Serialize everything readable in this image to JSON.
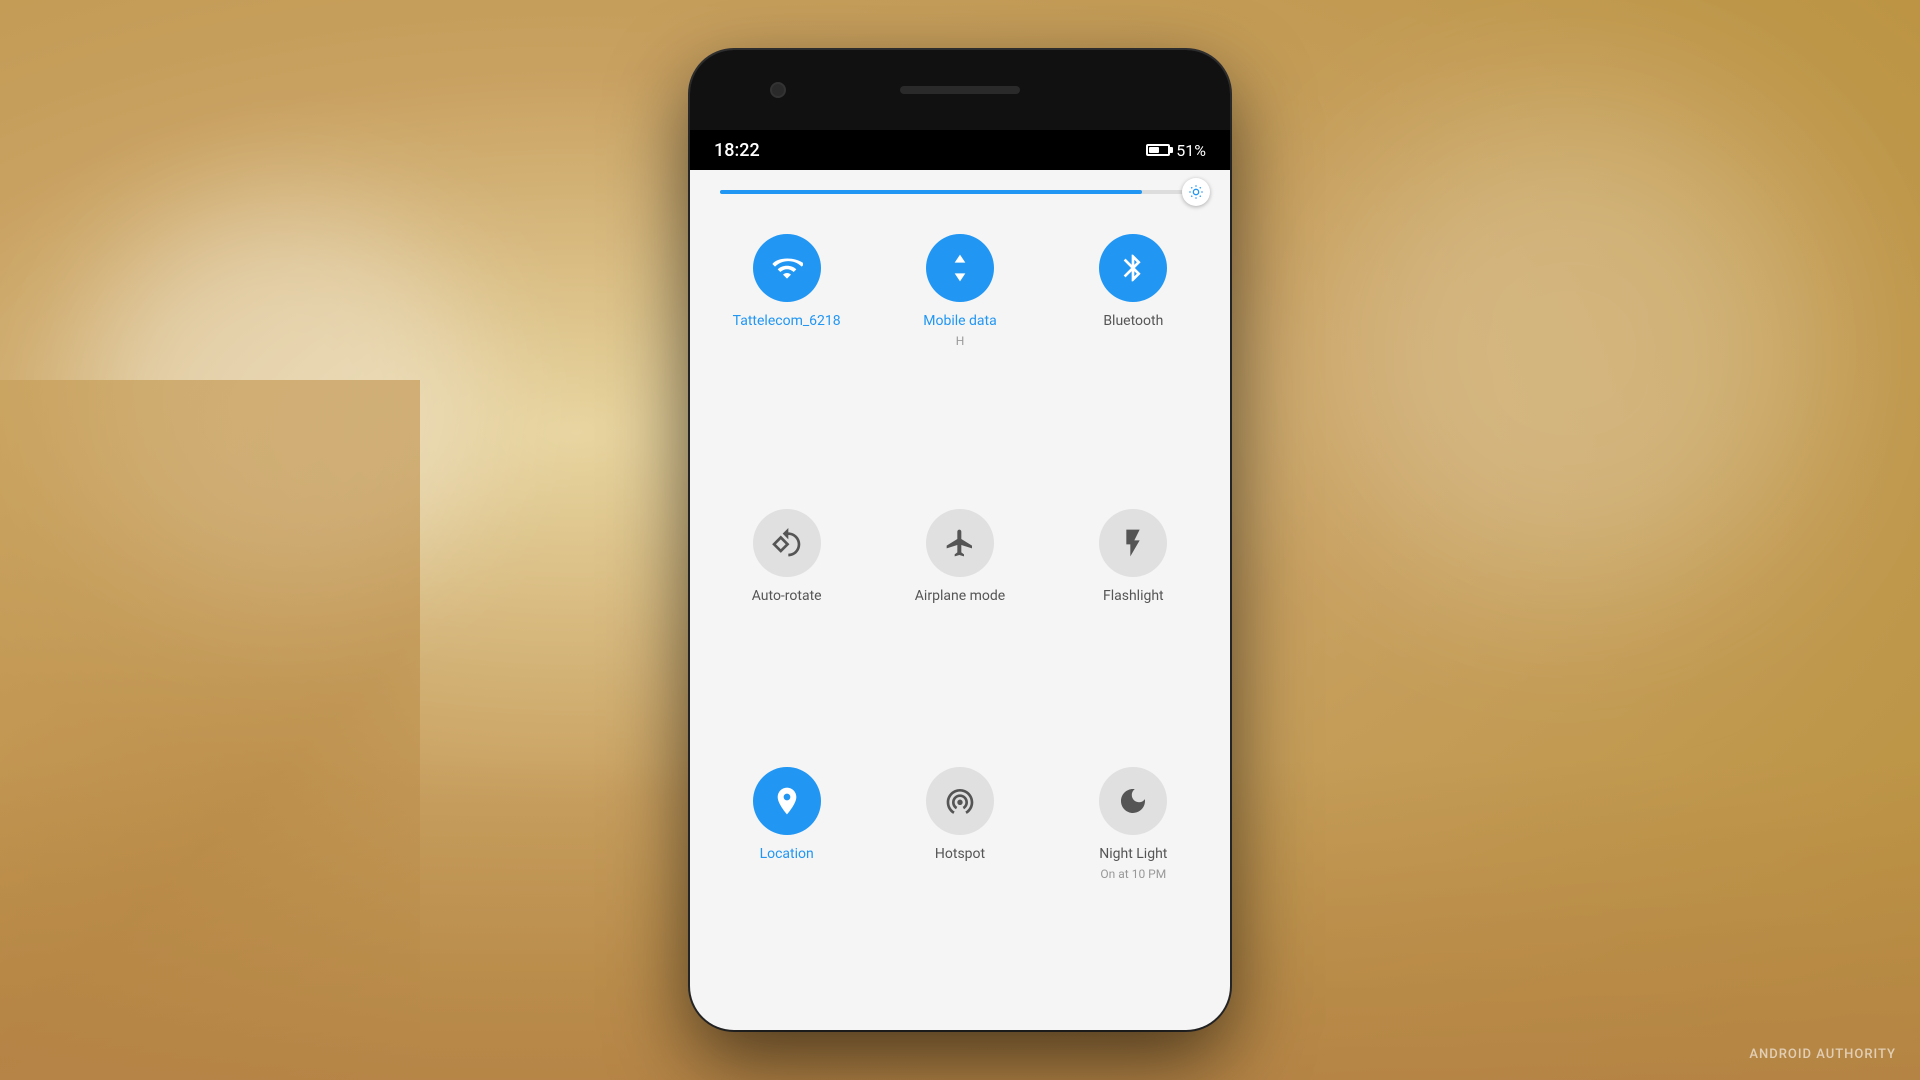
{
  "background": {
    "color": "#c8a060"
  },
  "status_bar": {
    "time": "18:22",
    "battery_percent": "51%"
  },
  "brightness_slider": {
    "fill_percent": 88,
    "aria_label": "Brightness slider"
  },
  "tiles": [
    {
      "id": "wifi",
      "label": "Tattelecom_6218",
      "sublabel": "",
      "active": true,
      "icon": "wifi"
    },
    {
      "id": "mobile-data",
      "label": "Mobile data",
      "sublabel": "H",
      "active": true,
      "icon": "mobile-data"
    },
    {
      "id": "bluetooth",
      "label": "Bluetooth",
      "sublabel": "",
      "active": true,
      "icon": "bluetooth"
    },
    {
      "id": "auto-rotate",
      "label": "Auto-rotate",
      "sublabel": "",
      "active": false,
      "icon": "auto-rotate"
    },
    {
      "id": "airplane",
      "label": "Airplane mode",
      "sublabel": "",
      "active": false,
      "icon": "airplane"
    },
    {
      "id": "flashlight",
      "label": "Flashlight",
      "sublabel": "",
      "active": false,
      "icon": "flashlight"
    },
    {
      "id": "location",
      "label": "Location",
      "sublabel": "",
      "active": true,
      "icon": "location"
    },
    {
      "id": "hotspot",
      "label": "Hotspot",
      "sublabel": "",
      "active": false,
      "icon": "hotspot"
    },
    {
      "id": "night-light",
      "label": "Night Light",
      "sublabel": "On at 10 PM",
      "active": false,
      "icon": "night-light"
    }
  ],
  "watermark": "ANDROID AUTHORITY"
}
